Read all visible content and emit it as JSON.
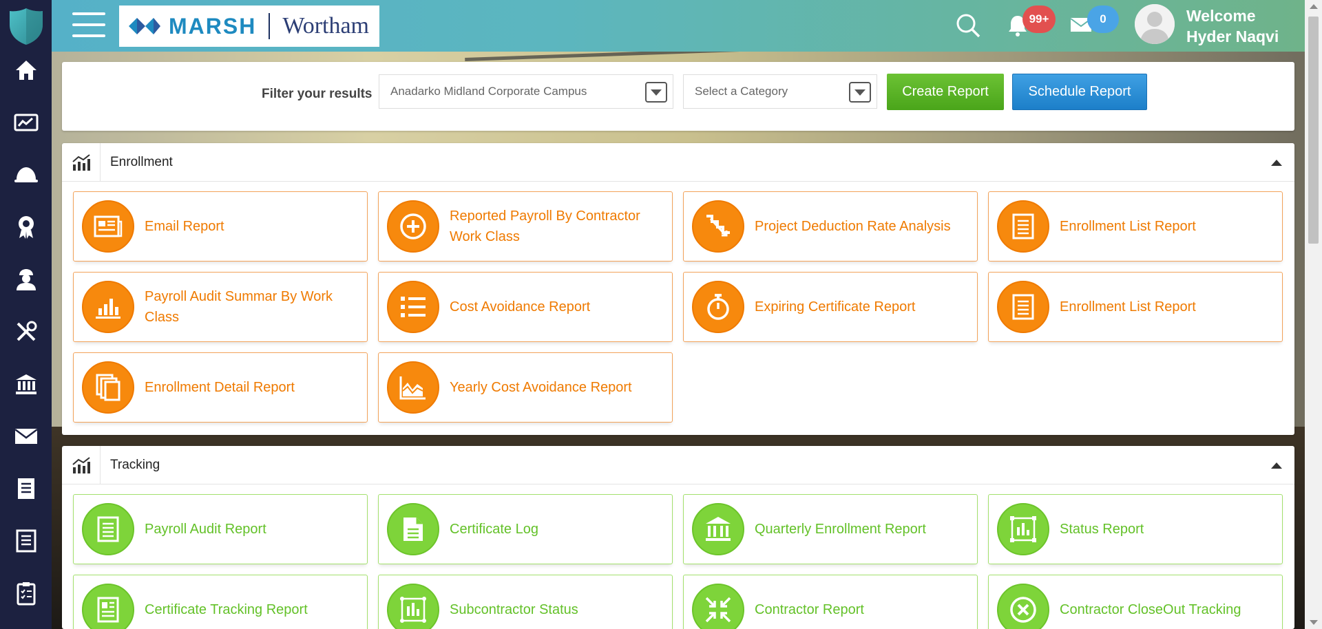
{
  "header": {
    "brand_left": "MARSH",
    "brand_right": "Wortham",
    "notifications_badge": "99+",
    "messages_badge": "0",
    "welcome_line1": "Welcome",
    "welcome_line2": "Hyder Naqvi"
  },
  "sidebar": {
    "items": [
      {
        "icon": "home-icon"
      },
      {
        "icon": "dashboard-icon"
      },
      {
        "icon": "helmet-icon"
      },
      {
        "icon": "award-icon"
      },
      {
        "icon": "worker-icon"
      },
      {
        "icon": "tools-icon"
      },
      {
        "icon": "bank-icon"
      },
      {
        "icon": "mail-icon"
      },
      {
        "icon": "document-icon"
      },
      {
        "icon": "newspaper-icon"
      },
      {
        "icon": "clipboard-icon"
      }
    ]
  },
  "filter": {
    "label": "Filter your results",
    "project_value": "Anadarko Midland Corporate Campus",
    "category_placeholder": "Select a Category",
    "create_button": "Create Report",
    "schedule_button": "Schedule Report"
  },
  "enrollment": {
    "title": "Enrollment",
    "cards": [
      {
        "label": "Email Report",
        "icon": "newspaper-icon"
      },
      {
        "label": "Reported Payroll By Contractor Work Class",
        "icon": "plus-circle-icon"
      },
      {
        "label": "Project Deduction Rate Analysis",
        "icon": "stairs-down-icon"
      },
      {
        "label": "Enrollment List Report",
        "icon": "document-list-icon"
      },
      {
        "label": "Payroll Audit Summar By Work Class",
        "icon": "bar-chart-icon"
      },
      {
        "label": "Cost Avoidance Report",
        "icon": "list-icon"
      },
      {
        "label": "Expiring Certificate Report",
        "icon": "stopwatch-icon"
      },
      {
        "label": "Enrollment List Report",
        "icon": "document-list-icon"
      },
      {
        "label": "Enrollment Detail Report",
        "icon": "copy-icon"
      },
      {
        "label": "Yearly Cost Avoidance Report",
        "icon": "area-chart-icon"
      }
    ]
  },
  "tracking": {
    "title": "Tracking",
    "cards": [
      {
        "label": "Payroll Audit Report",
        "icon": "document-list-icon"
      },
      {
        "label": "Certificate Log",
        "icon": "file-text-icon"
      },
      {
        "label": "Quarterly Enrollment Report",
        "icon": "bank-icon"
      },
      {
        "label": "Status Report",
        "icon": "chart-box-icon"
      },
      {
        "label": "Certificate Tracking Report",
        "icon": "id-document-icon"
      },
      {
        "label": "Subcontractor Status",
        "icon": "chart-frame-icon"
      },
      {
        "label": "Contractor Report",
        "icon": "compress-icon"
      },
      {
        "label": "Contractor CloseOut Tracking",
        "icon": "close-circle-icon"
      }
    ]
  },
  "colors": {
    "sidebar": "#1c2140",
    "orange": "#f7890d",
    "green": "#7ed43a",
    "create": "#4aa51a",
    "schedule": "#1c7fc9"
  }
}
